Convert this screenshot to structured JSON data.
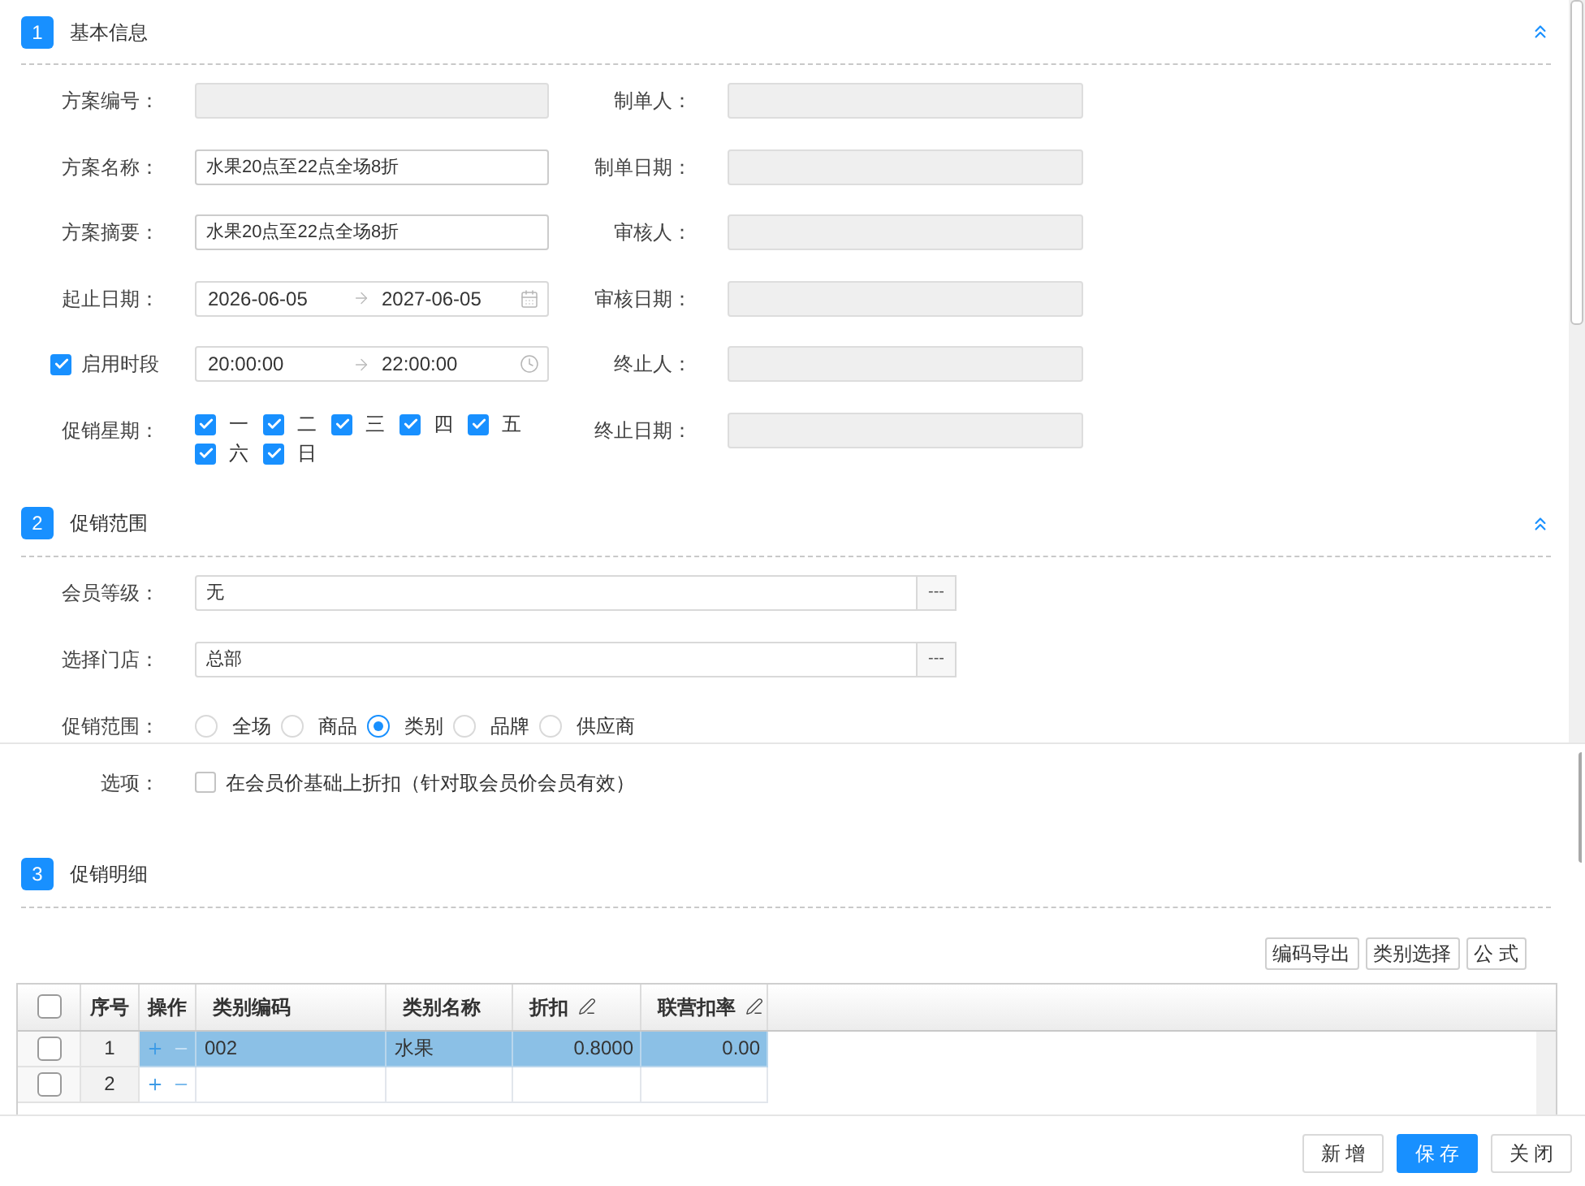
{
  "basic_info": {
    "number": "1",
    "title": "基本信息",
    "expanded": true,
    "left_fields": [
      {
        "kind": "text",
        "label": "方案编号：",
        "disabled": true
      },
      {
        "kind": "text",
        "label": "方案名称：",
        "value": "水果20点至22点全场8折",
        "disabled": false
      },
      {
        "kind": "text",
        "label": "方案摘要：",
        "value": "水果20点至22点全场8折",
        "disabled": false
      },
      {
        "kind": "date_range",
        "label": "起止日期：",
        "start": "2026-06-05",
        "end": "2027-06-05"
      },
      {
        "kind": "time_range",
        "label": "启用时段",
        "checked": true,
        "start": "20:00:00",
        "end": "22:00:00"
      },
      {
        "kind": "weekdays",
        "label": "促销星期：",
        "days": [
          {
            "label": "一",
            "checked": true
          },
          {
            "label": "二",
            "checked": true
          },
          {
            "label": "三",
            "checked": true
          },
          {
            "label": "四",
            "checked": true
          },
          {
            "label": "五",
            "checked": true
          },
          {
            "label": "六",
            "checked": true
          },
          {
            "label": "日",
            "checked": true
          }
        ]
      }
    ],
    "right_fields": [
      {
        "label": "制单人：",
        "disabled": true
      },
      {
        "label": "制单日期：",
        "disabled": true
      },
      {
        "label": "审核人：",
        "disabled": true
      },
      {
        "label": "审核日期：",
        "disabled": true
      },
      {
        "label": "终止人：",
        "disabled": true
      },
      {
        "label": "终止日期：",
        "disabled": true
      }
    ]
  },
  "promotion_scope": {
    "number": "2",
    "title": "促销范围",
    "expanded": true,
    "fields": [
      {
        "kind": "picker",
        "label": "会员等级：",
        "value": "无",
        "button": "---"
      },
      {
        "kind": "picker",
        "label": "选择门店：",
        "value": "总部",
        "button": "---"
      },
      {
        "kind": "radios",
        "label": "促销范围：",
        "options": [
          {
            "label": "全场",
            "selected": false
          },
          {
            "label": "商品",
            "selected": false
          },
          {
            "label": "类别",
            "selected": true
          },
          {
            "label": "品牌",
            "selected": false
          },
          {
            "label": "供应商",
            "selected": false
          }
        ]
      }
    ]
  },
  "option": {
    "label": "选项：",
    "checked": false,
    "text": "在会员价基础上折扣（针对取会员价会员有效）"
  },
  "details": {
    "number": "3",
    "title": "促销明细",
    "toolbar": [
      "编码导出",
      "类别选择",
      "公 式"
    ],
    "table": {
      "all_checked": false,
      "columns": [
        {
          "label": "序号",
          "editable": false
        },
        {
          "label": "操作",
          "editable": false
        },
        {
          "label": "类别编码",
          "editable": false
        },
        {
          "label": "类别名称",
          "editable": false
        },
        {
          "label": "折扣",
          "editable": true
        },
        {
          "label": "联营扣率",
          "editable": true
        }
      ],
      "rows": [
        {
          "checked": false,
          "selected": true,
          "number": "1",
          "code": "002",
          "name": "水果",
          "discount": "0.8000",
          "rate": "0.00"
        },
        {
          "checked": false,
          "selected": false,
          "number": "2"
        }
      ]
    }
  },
  "footer_buttons": [
    {
      "label": "新 增",
      "primary": false
    },
    {
      "label": "保 存",
      "primary": true
    },
    {
      "label": "关 闭",
      "primary": false
    }
  ]
}
